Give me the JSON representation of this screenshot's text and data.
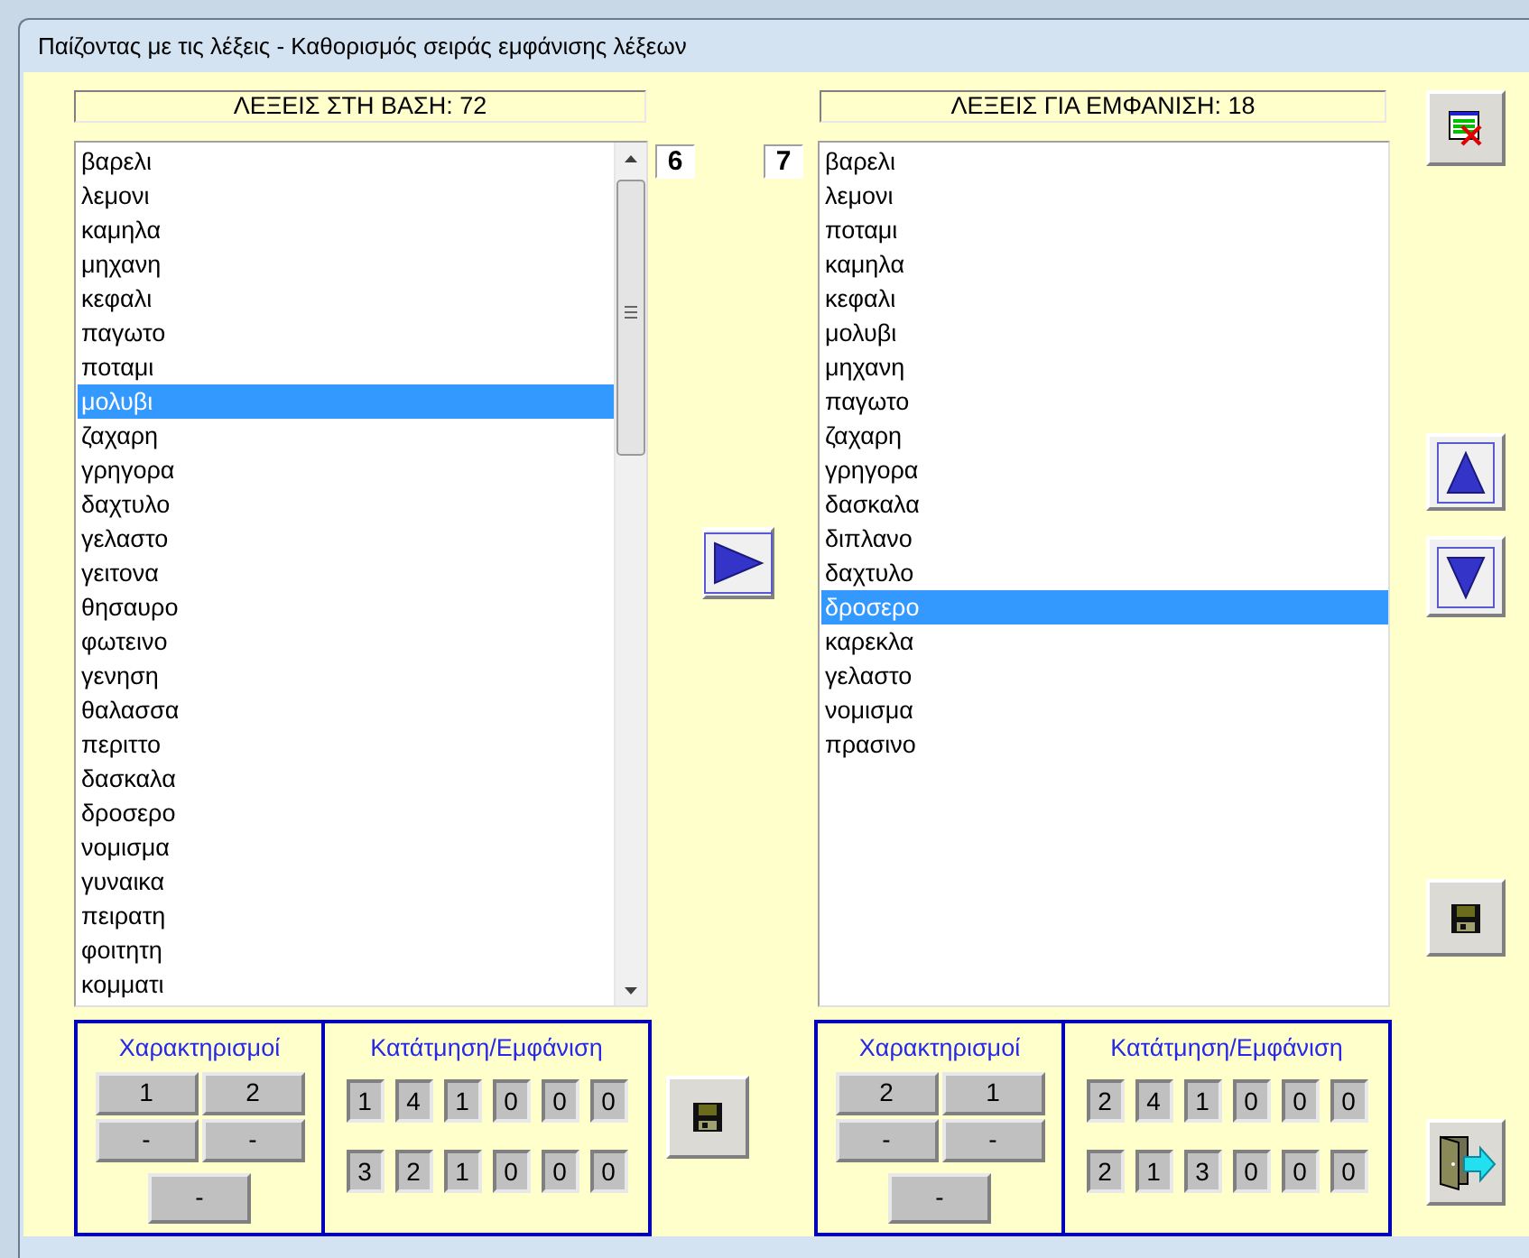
{
  "window": {
    "title": "Παίζοντας με τις λέξεις - Καθορισμός σειράς εμφάνισης λέξεων"
  },
  "source": {
    "header": "ΛΕΞΕΙΣ ΣΤΗ ΒΑΣΗ: 72",
    "words": [
      {
        "text": "βαρελι",
        "selected": false
      },
      {
        "text": "λεμονι",
        "selected": false
      },
      {
        "text": "καμηλα",
        "selected": false
      },
      {
        "text": "μηχανη",
        "selected": false
      },
      {
        "text": "κεφαλι",
        "selected": false
      },
      {
        "text": "παγωτο",
        "selected": false
      },
      {
        "text": "ποταμι",
        "selected": false
      },
      {
        "text": "μολυβι",
        "selected": true
      },
      {
        "text": "ζαχαρη",
        "selected": false
      },
      {
        "text": "γρηγορα",
        "selected": false
      },
      {
        "text": "δαχτυλο",
        "selected": false
      },
      {
        "text": "γελαστο",
        "selected": false
      },
      {
        "text": "γειτονα",
        "selected": false
      },
      {
        "text": "θησαυρο",
        "selected": false
      },
      {
        "text": "φωτεινο",
        "selected": false
      },
      {
        "text": "γενηση",
        "selected": false
      },
      {
        "text": "θαλασσα",
        "selected": false
      },
      {
        "text": "περιττο",
        "selected": false
      },
      {
        "text": "δασκαλα",
        "selected": false
      },
      {
        "text": "δροσερο",
        "selected": false
      },
      {
        "text": "νομισμα",
        "selected": false
      },
      {
        "text": "γυναικα",
        "selected": false
      },
      {
        "text": "πειρατη",
        "selected": false
      },
      {
        "text": "φοιτητη",
        "selected": false
      },
      {
        "text": "κομματι",
        "selected": false
      }
    ],
    "tags_title": "Χαρακτηρισμοί",
    "tags": [
      "1",
      "2",
      "-",
      "-",
      "-"
    ],
    "segments_title": "Κατάτμηση/Εμφάνιση",
    "segments": [
      [
        "1",
        "4",
        "1",
        "0",
        "0",
        "0"
      ],
      [
        "3",
        "2",
        "1",
        "0",
        "0",
        "0"
      ]
    ]
  },
  "counters": [
    "6",
    "7"
  ],
  "target": {
    "header": "ΛΕΞΕΙΣ ΓΙΑ ΕΜΦΑΝΙΣΗ: 18",
    "words": [
      {
        "text": "βαρελι",
        "selected": false
      },
      {
        "text": "λεμονι",
        "selected": false
      },
      {
        "text": "ποταμι",
        "selected": false
      },
      {
        "text": "καμηλα",
        "selected": false
      },
      {
        "text": "κεφαλι",
        "selected": false
      },
      {
        "text": "μολυβι",
        "selected": false
      },
      {
        "text": "μηχανη",
        "selected": false
      },
      {
        "text": "παγωτο",
        "selected": false
      },
      {
        "text": "ζαχαρη",
        "selected": false
      },
      {
        "text": "γρηγορα",
        "selected": false
      },
      {
        "text": "δασκαλα",
        "selected": false
      },
      {
        "text": "διπλανο",
        "selected": false
      },
      {
        "text": "δαχτυλο",
        "selected": false
      },
      {
        "text": "δροσερο",
        "selected": true
      },
      {
        "text": "καρεκλα",
        "selected": false
      },
      {
        "text": "γελαστο",
        "selected": false
      },
      {
        "text": "νομισμα",
        "selected": false
      },
      {
        "text": "πρασινο",
        "selected": false
      }
    ],
    "tags_title": "Χαρακτηρισμοί",
    "tags": [
      "2",
      "1",
      "-",
      "-",
      "-"
    ],
    "segments_title": "Κατάτμηση/Εμφάνιση",
    "segments": [
      [
        "2",
        "4",
        "1",
        "0",
        "0",
        "0"
      ],
      [
        "2",
        "1",
        "3",
        "0",
        "0",
        "0"
      ]
    ]
  }
}
